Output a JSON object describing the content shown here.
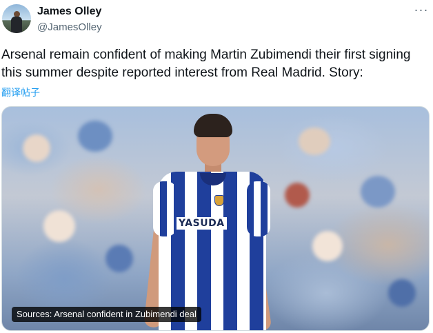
{
  "author": {
    "name": "James Olley",
    "handle": "@JamesOlley",
    "avatar_icon": "avatar"
  },
  "more_icon": "more-options-icon",
  "tweet": {
    "text": "Arsenal remain confident of making Martin Zubimendi their first signing this summer despite reported interest from Real Madrid. Story:",
    "translate_label": "翻译帖子"
  },
  "media": {
    "shirt_sponsor": "YASUDA",
    "caption": "Sources: Arsenal confident in Zubimendi deal"
  },
  "colors": {
    "link": "#1d9bf0",
    "muted": "#536471",
    "kit_blue": "#1f3f9c"
  }
}
